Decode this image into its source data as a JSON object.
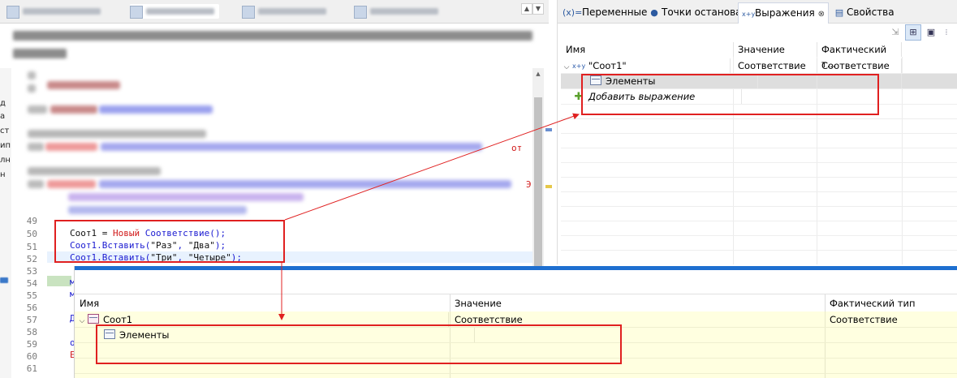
{
  "editor": {
    "line_numbers": [
      "49",
      "50",
      "51",
      "52",
      "53",
      "54",
      "55",
      "56",
      "57",
      "58",
      "59",
      "60",
      "61"
    ],
    "code_lines": [
      {
        "ln": "50",
        "parts": [
          {
            "t": "Соот1 = ",
            "c": "str"
          },
          {
            "t": "Новый",
            "c": "kw"
          },
          {
            "t": " Соответствие",
            "c": "fn"
          },
          {
            "t": "();",
            "c": "fn"
          }
        ]
      },
      {
        "ln": "51",
        "parts": [
          {
            "t": "Соот1.Вставить(",
            "c": "fn"
          },
          {
            "t": "\"Раз\"",
            "c": "str"
          },
          {
            "t": ", ",
            "c": "fn"
          },
          {
            "t": "\"Два\"",
            "c": "str"
          },
          {
            "t": ");",
            "c": "fn"
          }
        ]
      },
      {
        "ln": "52",
        "parts": [
          {
            "t": "Соот1.Вставить(",
            "c": "fn"
          },
          {
            "t": "\"Три\"",
            "c": "str"
          },
          {
            "t": ", ",
            "c": "fn"
          },
          {
            "t": "\"Четыре\"",
            "c": "str"
          },
          {
            "t": ");",
            "c": "fn"
          }
        ]
      }
    ],
    "line_53_start": "м",
    "line_55_start": "м",
    "line_57_start": "Д",
    "line_59_start": "о",
    "line_60_start": "Е",
    "tail_text": "от",
    "tail_text_2": "Э"
  },
  "left_strip_letters": [
    "д",
    "а",
    "ст",
    "ип",
    "лн",
    "н",
    "",
    ""
  ],
  "variables_panel": {
    "tabs": [
      {
        "icon": "(x)=",
        "label": "Переменные",
        "active": false
      },
      {
        "icon": "●",
        "label": "Точки останова",
        "active": false
      },
      {
        "icon": "x+y",
        "label": "Выражения",
        "active": true,
        "close": "⊗"
      },
      {
        "icon": "▤",
        "label": "Свойства",
        "active": false
      }
    ],
    "columns": [
      "Имя",
      "Значение",
      "Фактический т..."
    ],
    "rows": [
      {
        "name": "\"Соот1\"",
        "value": "Соответствие",
        "type": "Соответствие",
        "expanded": true,
        "icon": "x+y"
      },
      {
        "name": "Элементы",
        "value": "",
        "type": "",
        "icon": "table"
      },
      {
        "name": "Добавить выражение",
        "value": "",
        "type": "",
        "icon": "plus"
      }
    ]
  },
  "bottom_panel": {
    "columns": [
      "Имя",
      "Значение",
      "Фактический тип"
    ],
    "rows": [
      {
        "name": "Соот1",
        "value": "Соответствие",
        "type": "Соответствие"
      },
      {
        "name": "Элементы",
        "value": "",
        "type": ""
      }
    ]
  },
  "colors": {
    "annotation_red": "#e02020",
    "accent_blue": "#1e6fd0",
    "bottom_row_bg": "#ffffe0",
    "keyword_red": "#d11a1a",
    "code_blue": "#1a1ad1"
  }
}
